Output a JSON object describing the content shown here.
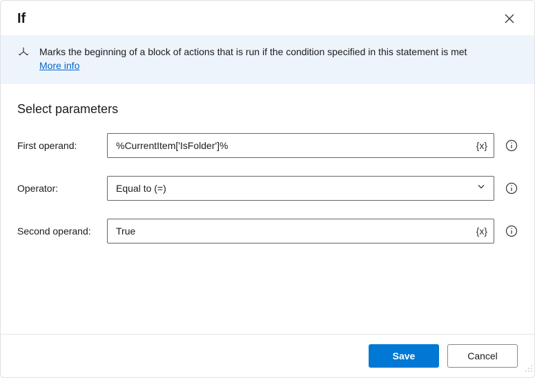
{
  "dialog": {
    "title": "If",
    "banner_text": "Marks the beginning of a block of actions that is run if the condition specified in this statement is met",
    "more_info_label": "More info"
  },
  "parameters": {
    "section_title": "Select parameters",
    "first_operand": {
      "label": "First operand:",
      "value": "%CurrentItem['IsFolder']%",
      "suffix": "{x}"
    },
    "operator": {
      "label": "Operator:",
      "value": "Equal to (=)"
    },
    "second_operand": {
      "label": "Second operand:",
      "value": "True",
      "suffix": "{x}"
    }
  },
  "footer": {
    "save_label": "Save",
    "cancel_label": "Cancel"
  }
}
